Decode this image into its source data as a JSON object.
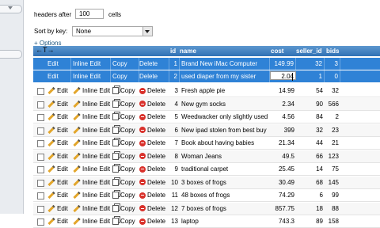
{
  "controls": {
    "headers_after_label": "headers after",
    "headers_after_value": "100",
    "cells_label": "cells",
    "sort_by_key_label": "Sort by key:",
    "sort_by_key_value": "None",
    "options_link": "+ Options"
  },
  "table": {
    "nav_arrows": "←T→",
    "columns": [
      "id",
      "name",
      "cost",
      "seller_id",
      "bids"
    ],
    "actions": {
      "edit": "Edit",
      "inline_edit": "Inline Edit",
      "copy": "Copy",
      "delete": "Delete"
    },
    "selected_rows": [
      {
        "id": "1",
        "name": "Brand New iMac Computer",
        "cost": "149.99",
        "seller_id": "32",
        "bids": "3"
      },
      {
        "id": "2",
        "name": "used diaper from my sister",
        "cost": "2.04",
        "seller_id": "1",
        "bids": "0"
      }
    ],
    "rows": [
      {
        "id": "3",
        "name": "Fresh apple pie",
        "cost": "14.99",
        "seller_id": "54",
        "bids": "32"
      },
      {
        "id": "4",
        "name": "New gym socks",
        "cost": "2.34",
        "seller_id": "90",
        "bids": "566"
      },
      {
        "id": "5",
        "name": "Weedwacker only slightly used",
        "cost": "4.56",
        "seller_id": "84",
        "bids": "2"
      },
      {
        "id": "6",
        "name": "New ipad stolen from best buy",
        "cost": "399",
        "seller_id": "32",
        "bids": "23"
      },
      {
        "id": "7",
        "name": "Book about having babies",
        "cost": "21.34",
        "seller_id": "44",
        "bids": "21"
      },
      {
        "id": "8",
        "name": "Woman Jeans",
        "cost": "49.5",
        "seller_id": "66",
        "bids": "123"
      },
      {
        "id": "9",
        "name": "traditional carpet",
        "cost": "25.45",
        "seller_id": "14",
        "bids": "75"
      },
      {
        "id": "10",
        "name": "3 boxes of frogs",
        "cost": "30.49",
        "seller_id": "68",
        "bids": "145"
      },
      {
        "id": "11",
        "name": "48 boxes of frogs",
        "cost": "74.29",
        "seller_id": "6",
        "bids": "99"
      },
      {
        "id": "12",
        "name": "7 boxes of frogs",
        "cost": "857.75",
        "seller_id": "18",
        "bids": "88"
      },
      {
        "id": "13",
        "name": "laptop",
        "cost": "743.3",
        "seller_id": "89",
        "bids": "158"
      }
    ]
  }
}
